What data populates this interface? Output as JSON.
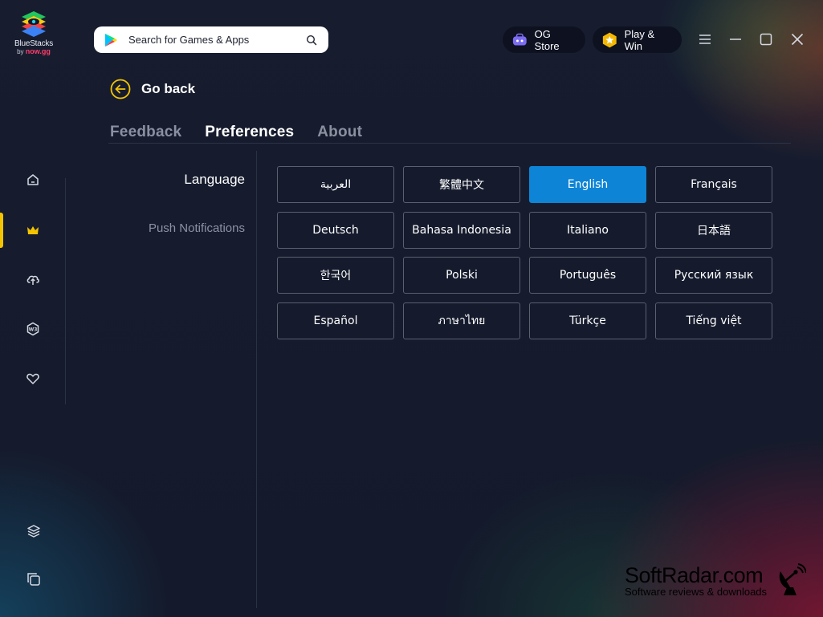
{
  "brand": {
    "name": "BlueStacks",
    "by": "by",
    "by_brand": "now.gg"
  },
  "search": {
    "placeholder": "Search for Games & Apps"
  },
  "header": {
    "og_store": "OG Store",
    "play_win": "Play & Win"
  },
  "nav": {
    "go_back": "Go back"
  },
  "tabs": [
    {
      "label": "Feedback",
      "active": false
    },
    {
      "label": "Preferences",
      "active": true
    },
    {
      "label": "About",
      "active": false
    }
  ],
  "settings_nav": {
    "language": "Language",
    "push_notifications": "Push Notifications"
  },
  "languages": [
    "العربية",
    "繁體中文",
    "English",
    "Français",
    "Deutsch",
    "Bahasa Indonesia",
    "Italiano",
    "日本語",
    "한국어",
    "Polski",
    "Português",
    "Русский язык",
    "Español",
    "ภาษาไทย",
    "Türkçe",
    "Tiếng việt"
  ],
  "selected_language": "English",
  "colors": {
    "accent": "#0d84d6",
    "highlight": "#f5c400",
    "background": "#151b2d"
  },
  "sidebar_icons": [
    "home-icon",
    "crown-icon",
    "cloud-upload-icon",
    "web3-icon",
    "heart-icon"
  ],
  "watermark": {
    "title": "SoftRadar.com",
    "subtitle": "Software reviews & downloads"
  }
}
